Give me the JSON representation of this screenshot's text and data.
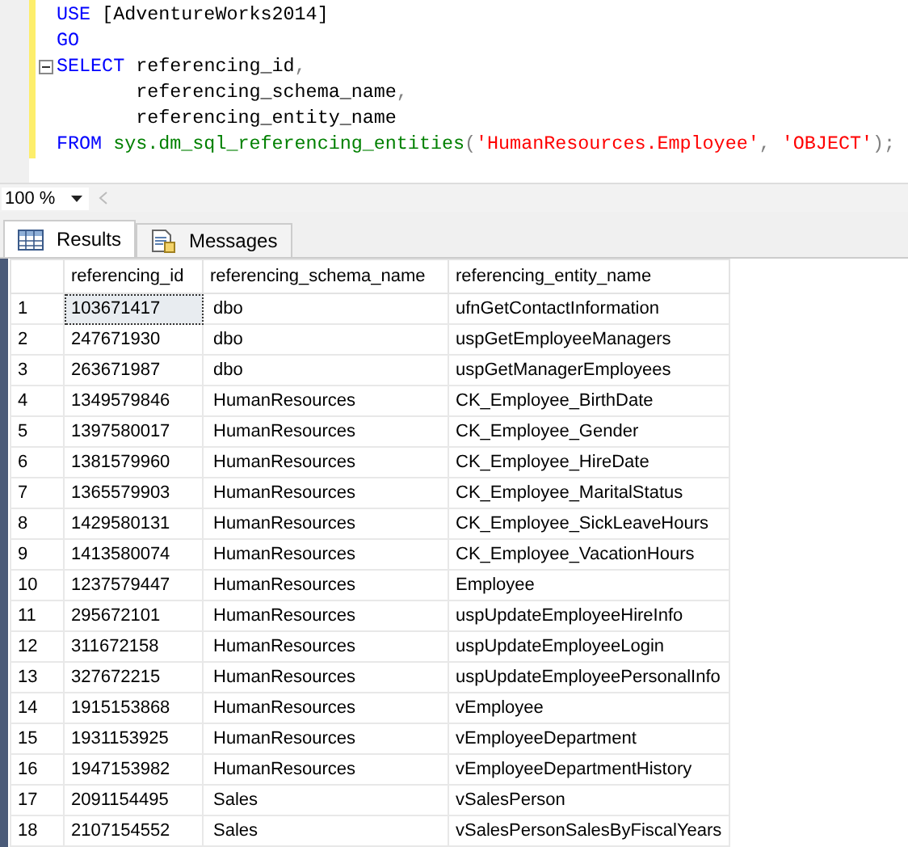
{
  "editor": {
    "lines": [
      {
        "foldable": false,
        "tokens": [
          {
            "text": "USE",
            "kind": "keyword"
          },
          {
            "text": " [AdventureWorks2014]",
            "kind": "plain"
          }
        ]
      },
      {
        "foldable": false,
        "tokens": [
          {
            "text": "GO",
            "kind": "keyword"
          }
        ]
      },
      {
        "foldable": true,
        "tokens": [
          {
            "text": "SELECT",
            "kind": "keyword"
          },
          {
            "text": " referencing_id",
            "kind": "plain"
          },
          {
            "text": ",",
            "kind": "punct"
          }
        ]
      },
      {
        "foldable": false,
        "tokens": [
          {
            "text": "       referencing_schema_name",
            "kind": "plain"
          },
          {
            "text": ",",
            "kind": "punct"
          }
        ]
      },
      {
        "foldable": false,
        "tokens": [
          {
            "text": "       referencing_entity_name",
            "kind": "plain"
          }
        ]
      },
      {
        "foldable": false,
        "tokens": [
          {
            "text": "FROM",
            "kind": "keyword"
          },
          {
            "text": " sys.dm_sql_referencing_entities",
            "kind": "function"
          },
          {
            "text": "(",
            "kind": "punct"
          },
          {
            "text": "'HumanResources.Employee'",
            "kind": "string"
          },
          {
            "text": ", ",
            "kind": "punct"
          },
          {
            "text": "'OBJECT'",
            "kind": "string"
          },
          {
            "text": ");",
            "kind": "punct"
          }
        ]
      }
    ]
  },
  "zoom": {
    "value": "100 %"
  },
  "tabs": [
    {
      "label": "Results",
      "selected": true
    },
    {
      "label": "Messages",
      "selected": false
    }
  ],
  "table": {
    "columns": [
      "referencing_id",
      "referencing_schema_name",
      "referencing_entity_name"
    ],
    "rows": [
      {
        "number": "1",
        "selected": true,
        "cells": [
          "103671417",
          "dbo",
          "ufnGetContactInformation"
        ]
      },
      {
        "number": "2",
        "selected": false,
        "cells": [
          "247671930",
          "dbo",
          "uspGetEmployeeManagers"
        ]
      },
      {
        "number": "3",
        "selected": false,
        "cells": [
          "263671987",
          "dbo",
          "uspGetManagerEmployees"
        ]
      },
      {
        "number": "4",
        "selected": false,
        "cells": [
          "1349579846",
          "HumanResources",
          "CK_Employee_BirthDate"
        ]
      },
      {
        "number": "5",
        "selected": false,
        "cells": [
          "1397580017",
          "HumanResources",
          "CK_Employee_Gender"
        ]
      },
      {
        "number": "6",
        "selected": false,
        "cells": [
          "1381579960",
          "HumanResources",
          "CK_Employee_HireDate"
        ]
      },
      {
        "number": "7",
        "selected": false,
        "cells": [
          "1365579903",
          "HumanResources",
          "CK_Employee_MaritalStatus"
        ]
      },
      {
        "number": "8",
        "selected": false,
        "cells": [
          "1429580131",
          "HumanResources",
          "CK_Employee_SickLeaveHours"
        ]
      },
      {
        "number": "9",
        "selected": false,
        "cells": [
          "1413580074",
          "HumanResources",
          "CK_Employee_VacationHours"
        ]
      },
      {
        "number": "10",
        "selected": false,
        "cells": [
          "1237579447",
          "HumanResources",
          "Employee"
        ]
      },
      {
        "number": "11",
        "selected": false,
        "cells": [
          "295672101",
          "HumanResources",
          "uspUpdateEmployeeHireInfo"
        ]
      },
      {
        "number": "12",
        "selected": false,
        "cells": [
          "311672158",
          "HumanResources",
          "uspUpdateEmployeeLogin"
        ]
      },
      {
        "number": "13",
        "selected": false,
        "cells": [
          "327672215",
          "HumanResources",
          "uspUpdateEmployeePersonalInfo"
        ]
      },
      {
        "number": "14",
        "selected": false,
        "cells": [
          "1915153868",
          "HumanResources",
          "vEmployee"
        ]
      },
      {
        "number": "15",
        "selected": false,
        "cells": [
          "1931153925",
          "HumanResources",
          "vEmployeeDepartment"
        ]
      },
      {
        "number": "16",
        "selected": false,
        "cells": [
          "1947153982",
          "HumanResources",
          "vEmployeeDepartmentHistory"
        ]
      },
      {
        "number": "17",
        "selected": false,
        "cells": [
          "2091154495",
          "Sales",
          "vSalesPerson"
        ]
      },
      {
        "number": "18",
        "selected": false,
        "cells": [
          "2107154552",
          "Sales",
          "vSalesPersonSalesByFiscalYears"
        ]
      }
    ]
  }
}
